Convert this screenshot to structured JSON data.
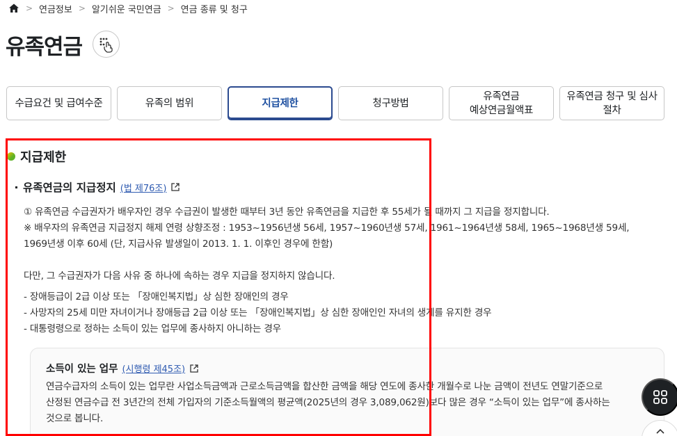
{
  "breadcrumb": {
    "items": [
      "연금정보",
      "알기쉬운 국민연금",
      "연금 종류 및 청구"
    ]
  },
  "page": {
    "title": "유족연금"
  },
  "tabs": [
    {
      "label": "수급요건 및 급여수준"
    },
    {
      "label": "유족의 범위"
    },
    {
      "label": "지급제한"
    },
    {
      "label": "청구방법"
    },
    {
      "label": "유족연금\n예상연금월액표"
    },
    {
      "label": "유족연금 청구 및 심사\n절차"
    }
  ],
  "content": {
    "section_title": "지급제한",
    "sub_title": "유족연금의 지급정지",
    "sub_law_link": "(법 제76조)",
    "paragraphs": [
      "① 유족연금 수급권자가 배우자인 경우 수급권이 발생한 때부터 3년 동안 유족연금을 지급한 후 55세가 될 때까지 그 지급을 정지합니다.",
      "※ 배우자의 유족연금 지급정지 해제 연령 상향조정 : 1953~1956년생 56세, 1957~1960년생 57세, 1961~1964년생 58세, 1965~1968년생 59세,",
      "1969년생 이후 60세 (단, 지급사유 발생일이 2013. 1. 1. 이후인 경우에 한함)",
      "다만, 그 수급권자가 다음 사유 중 하나에 속하는 경우 지급을 정지하지 않습니다."
    ],
    "list": [
      "장애등급이 2급 이상 또는 「장애인복지법」상 심한 장애인의 경우",
      "사망자의 25세 미만 자녀이거나 장애등급 2급 이상 또는 「장애인복지법」상 심한 장애인인 자녀의 생계를 유지한 경우",
      "대통령령으로 정하는 소득이 있는 업무에 종사하지 아니하는 경우"
    ],
    "info_box": {
      "title": "소득이 있는 업무",
      "law_link": "(시행령 제45조)",
      "lines": [
        "연금수급자의 소득이 있는 업무란 사업소득금액과 근로소득금액을 합산한 금액을 해당 연도에 종사한 개월수로 나눈 금액이 전년도 연말기준으로",
        "산정된 연금수급 전 3년간의 전체 가입자의 기준소득월액의 평균액(2025년의 경우 3,089,062원)보다 많은 경우 “소득이 있는 업무”에 종사하는",
        "것으로 봅니다."
      ]
    }
  },
  "colors": {
    "accent": "#2b4a8f",
    "link": "#2f5bb1",
    "highlight": "#ff0000"
  },
  "icons": {
    "home": "home-icon",
    "braille": "braille-hand-icon",
    "external": "external-link-icon",
    "menu": "grid-menu-icon",
    "top": "chevron-up-icon"
  }
}
